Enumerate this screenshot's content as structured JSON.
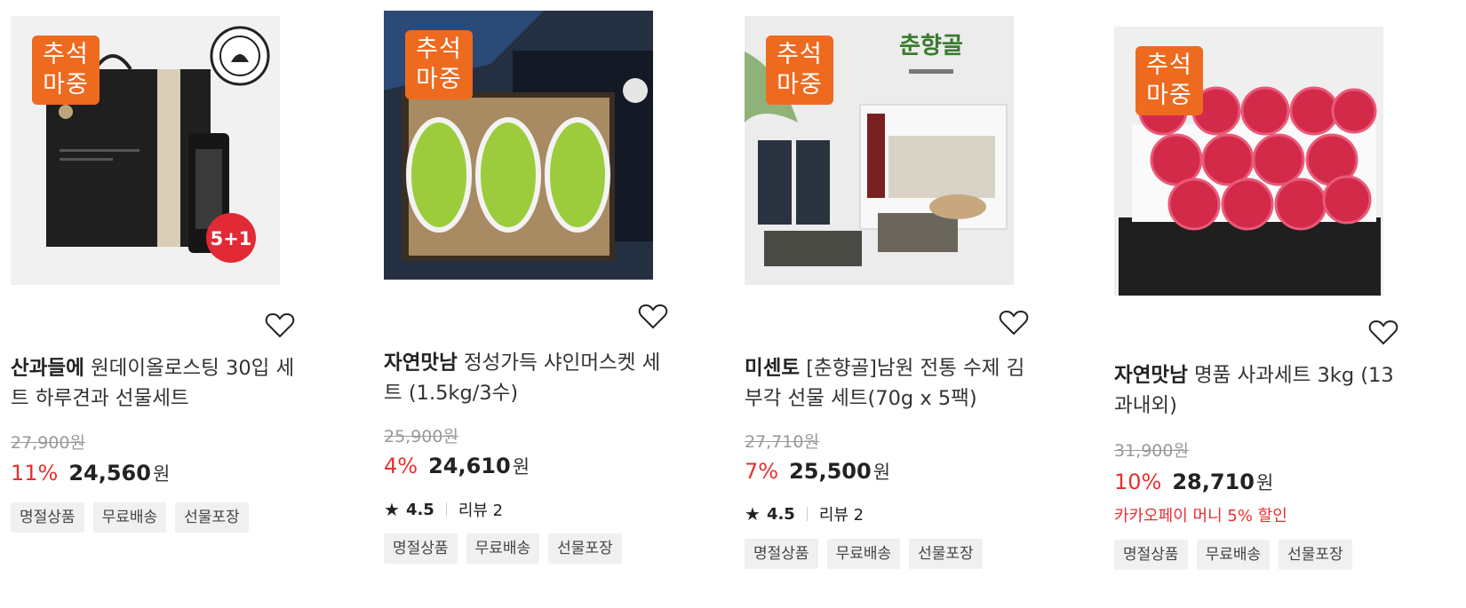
{
  "products": [
    {
      "badge": "추석\n마중",
      "sticker": "5+1",
      "brand": "산과들에",
      "name": "원데이올로스팅 30입 세트 하루견과 선물세트",
      "original_price": "27,900",
      "discount": "11%",
      "price": "24,560",
      "unit": "원",
      "tags": [
        "명절상품",
        "무료배송",
        "선물포장"
      ]
    },
    {
      "badge": "추석\n마중",
      "brand": "자연맛남",
      "name": "정성가득 샤인머스켓 세트 (1.5kg/3수)",
      "original_price": "25,900",
      "discount": "4%",
      "price": "24,610",
      "unit": "원",
      "rating": "4.5",
      "reviews": "리뷰 2",
      "tags": [
        "명절상품",
        "무료배송",
        "선물포장"
      ]
    },
    {
      "badge": "추석\n마중",
      "image_text": "춘향골",
      "brand": "미센토",
      "name": "[춘향골]남원 전통 수제 김부각 선물 세트(70g x 5팩)",
      "original_price": "27,710",
      "discount": "7%",
      "price": "25,500",
      "unit": "원",
      "rating": "4.5",
      "reviews": "리뷰 2",
      "tags": [
        "명절상품",
        "무료배송",
        "선물포장"
      ]
    },
    {
      "badge": "추석\n마중",
      "brand": "자연맛남",
      "name": "명품 사과세트 3kg (13과내외)",
      "original_price": "31,900",
      "discount": "10%",
      "price": "28,710",
      "unit": "원",
      "promo": "카카오페이 머니 5% 할인",
      "tags": [
        "명절상품",
        "무료배송",
        "선물포장"
      ]
    }
  ],
  "icons": {
    "wish": "heart-outline-icon",
    "rating": "star-icon"
  },
  "colors": {
    "badge": "#ee6a1f",
    "discount": "#e53030",
    "tag_bg": "#f0f0f0"
  }
}
